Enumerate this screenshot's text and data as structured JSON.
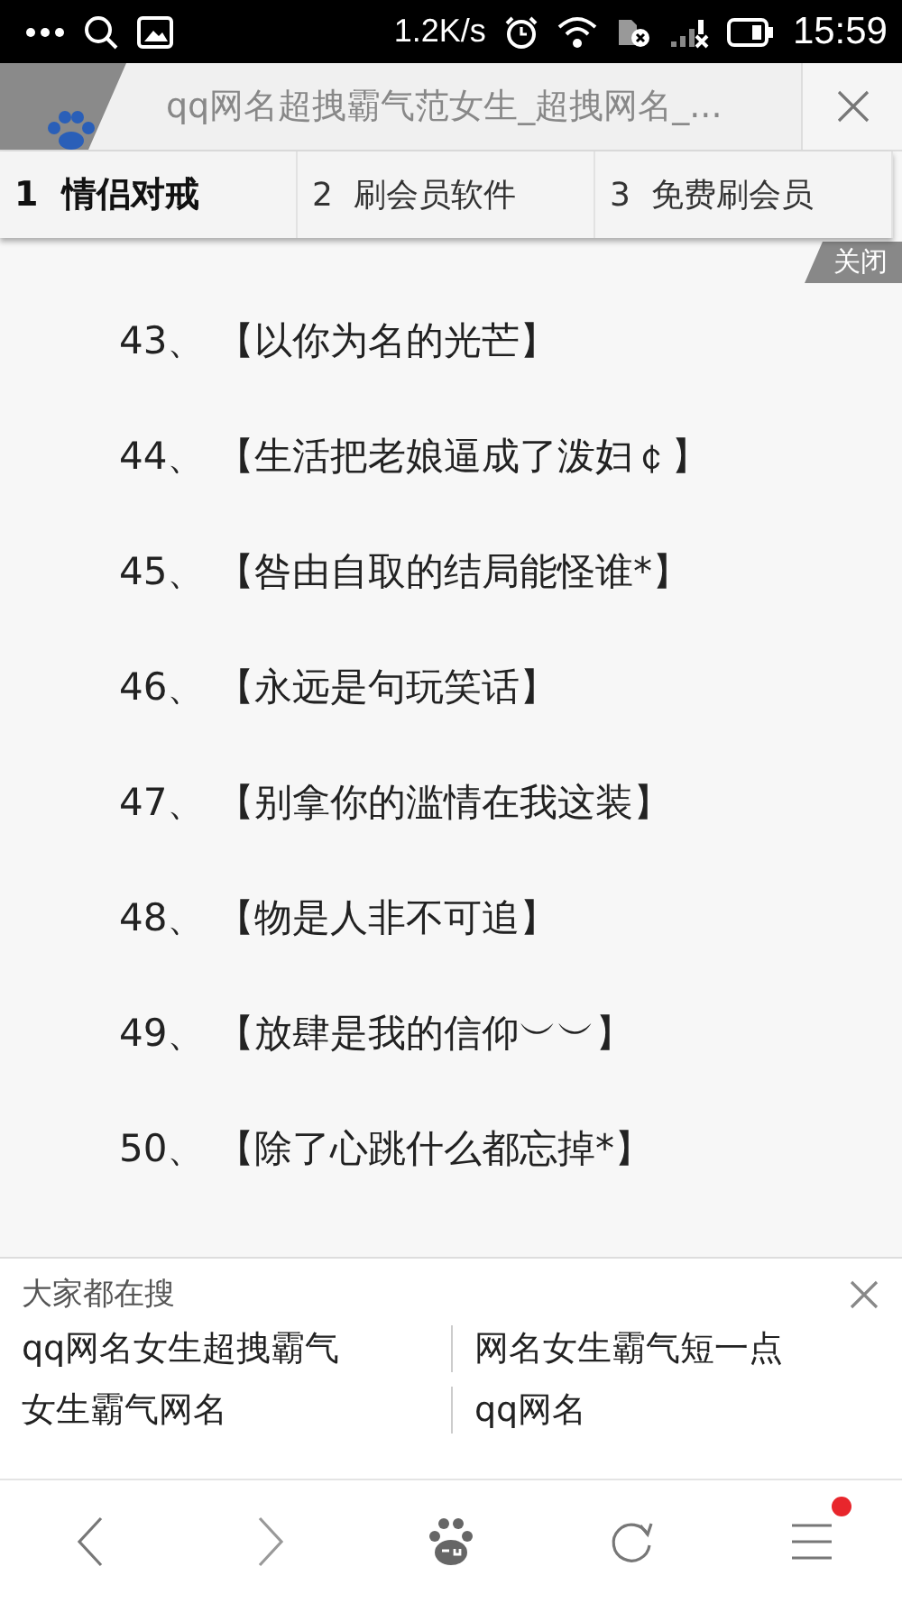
{
  "status_bar": {
    "speed": "1.2K/s",
    "time": "15:59"
  },
  "title_bar": {
    "title": "qq网名超拽霸气范女生_超拽网名_..."
  },
  "tabs": [
    {
      "num": "1",
      "label": "情侣对戒",
      "selected": true
    },
    {
      "num": "2",
      "label": "刷会员软件",
      "selected": false
    },
    {
      "num": "3",
      "label": "免费刷会员",
      "selected": false
    }
  ],
  "close_badge": "关闭",
  "rows": [
    {
      "num": "43、",
      "text": "【以你为名的光芒】"
    },
    {
      "num": "44、",
      "text": "【生活把老娘逼成了泼妇￠】"
    },
    {
      "num": "45、",
      "text": "【咎由自取的结局能怪谁*】"
    },
    {
      "num": "46、",
      "text": "【永远是句玩笑话】"
    },
    {
      "num": "47、",
      "text": "【别拿你的滥情在我这装】"
    },
    {
      "num": "48、",
      "text": "【物是人非不可追】"
    },
    {
      "num": "49、",
      "text": "【放肆是我的信仰︶︶】"
    },
    {
      "num": "50、",
      "text": "【除了心跳什么都忘掉*】"
    }
  ],
  "search_panel": {
    "heading": "大家都在搜",
    "links": [
      "qq网名女生超拽霸气",
      "网名女生霸气短一点",
      "女生霸气网名",
      "qq网名"
    ]
  },
  "bottom_nav": {
    "menu_badge": true
  }
}
